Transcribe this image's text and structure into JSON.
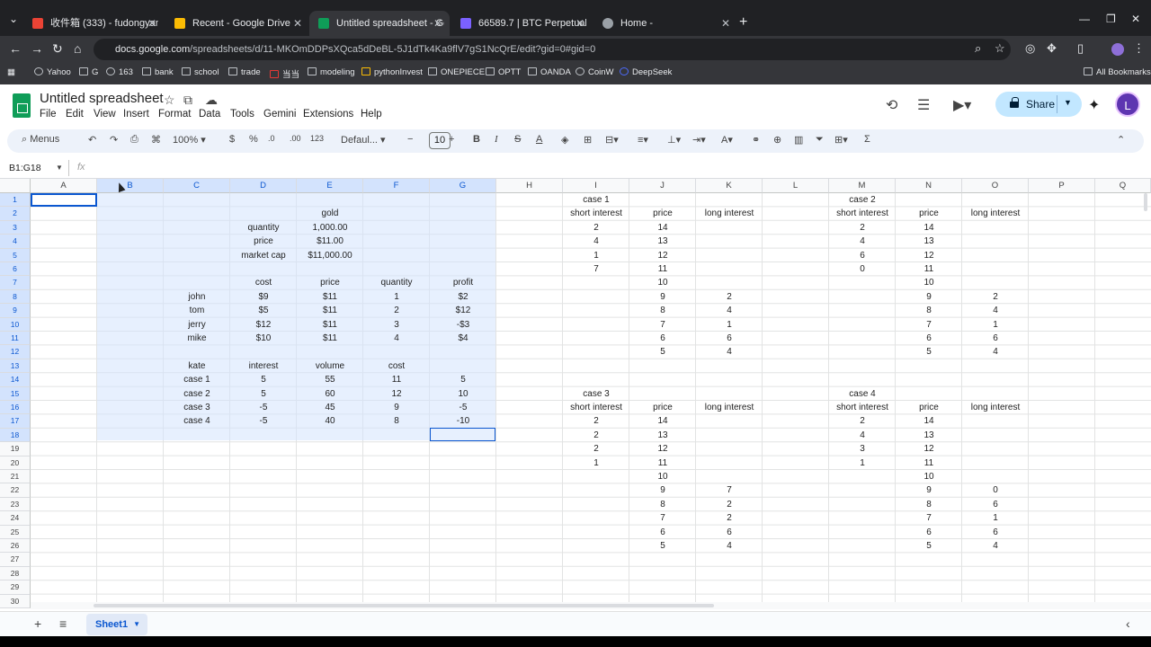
{
  "browser": {
    "tabs": [
      {
        "title": "收件箱 (333) - fudongyang880",
        "color": "#ea4335"
      },
      {
        "title": "Recent - Google Drive",
        "color": "#fbbc04"
      },
      {
        "title": "Untitled spreadsheet - Google",
        "color": "#0f9d58"
      },
      {
        "title": "66589.7 | BTC Perpetual | USDT",
        "color": "#7b61ff"
      },
      {
        "title": "Home -",
        "color": "#9aa0a6"
      }
    ],
    "url_host": "docs.google.com",
    "url_path": "/spreadsheets/d/11-MKOmDDPsXQca5dDeBL-5J1dTk4Ka9flV7gS1NcQrE/edit?gid=0#gid=0",
    "bookmarks": [
      "Yahoo",
      "G",
      "163",
      "bank",
      "school",
      "trade",
      "当当",
      "modeling",
      "pythonInvest",
      "ONEPIECE",
      "OPTT",
      "OANDA",
      "CoinW",
      "DeepSeek"
    ],
    "all_bookmarks": "All Bookmarks"
  },
  "sheets": {
    "title": "Untitled spreadsheet",
    "menu": [
      "File",
      "Edit",
      "View",
      "Insert",
      "Format",
      "Data",
      "Tools",
      "Gemini",
      "Extensions",
      "Help"
    ],
    "share_label": "Share",
    "avatar_letter": "L",
    "toolbar": {
      "menus": "Menus",
      "zoom": "100%",
      "currency": "$",
      "percent": "%",
      "dec_decrease": ".0",
      "dec_increase": ".00",
      "number_format": "123",
      "font": "Defaul...",
      "font_size": "10",
      "bold": "B",
      "italic": "I",
      "strikethrough": "S",
      "text_color": "A",
      "sum": "Σ"
    },
    "name_box": "B1:G18",
    "fx": "fx",
    "columns": [
      "A",
      "B",
      "C",
      "D",
      "E",
      "F",
      "G",
      "H",
      "I",
      "J",
      "K",
      "L",
      "M",
      "N",
      "O",
      "P",
      "Q"
    ],
    "rows": [
      "1",
      "2",
      "3",
      "4",
      "5",
      "6",
      "7",
      "8",
      "9",
      "10",
      "11",
      "12",
      "13",
      "14",
      "15",
      "16",
      "17",
      "18",
      "19",
      "20",
      "21",
      "22",
      "23",
      "24",
      "25",
      "26",
      "27",
      "28",
      "29",
      "30"
    ],
    "sheet_tab": "Sheet1",
    "cells": [
      {
        "c": "E",
        "r": 2,
        "v": "gold"
      },
      {
        "c": "D",
        "r": 3,
        "v": "quantity"
      },
      {
        "c": "E",
        "r": 3,
        "v": "1,000.00"
      },
      {
        "c": "D",
        "r": 4,
        "v": "price"
      },
      {
        "c": "E",
        "r": 4,
        "v": "$11.00"
      },
      {
        "c": "D",
        "r": 5,
        "v": "market cap"
      },
      {
        "c": "E",
        "r": 5,
        "v": "$11,000.00"
      },
      {
        "c": "D",
        "r": 7,
        "v": "cost"
      },
      {
        "c": "E",
        "r": 7,
        "v": "price"
      },
      {
        "c": "F",
        "r": 7,
        "v": "quantity"
      },
      {
        "c": "G",
        "r": 7,
        "v": "profit"
      },
      {
        "c": "C",
        "r": 8,
        "v": "john"
      },
      {
        "c": "D",
        "r": 8,
        "v": "$9"
      },
      {
        "c": "E",
        "r": 8,
        "v": "$11"
      },
      {
        "c": "F",
        "r": 8,
        "v": "1"
      },
      {
        "c": "G",
        "r": 8,
        "v": "$2"
      },
      {
        "c": "C",
        "r": 9,
        "v": "tom"
      },
      {
        "c": "D",
        "r": 9,
        "v": "$5"
      },
      {
        "c": "E",
        "r": 9,
        "v": "$11"
      },
      {
        "c": "F",
        "r": 9,
        "v": "2"
      },
      {
        "c": "G",
        "r": 9,
        "v": "$12"
      },
      {
        "c": "C",
        "r": 10,
        "v": "jerry"
      },
      {
        "c": "D",
        "r": 10,
        "v": "$12"
      },
      {
        "c": "E",
        "r": 10,
        "v": "$11"
      },
      {
        "c": "F",
        "r": 10,
        "v": "3"
      },
      {
        "c": "G",
        "r": 10,
        "v": "-$3"
      },
      {
        "c": "C",
        "r": 11,
        "v": "mike"
      },
      {
        "c": "D",
        "r": 11,
        "v": "$10"
      },
      {
        "c": "E",
        "r": 11,
        "v": "$11"
      },
      {
        "c": "F",
        "r": 11,
        "v": "4"
      },
      {
        "c": "G",
        "r": 11,
        "v": "$4"
      },
      {
        "c": "C",
        "r": 13,
        "v": "kate"
      },
      {
        "c": "D",
        "r": 13,
        "v": "interest"
      },
      {
        "c": "E",
        "r": 13,
        "v": "volume"
      },
      {
        "c": "F",
        "r": 13,
        "v": "cost"
      },
      {
        "c": "C",
        "r": 14,
        "v": "case 1"
      },
      {
        "c": "D",
        "r": 14,
        "v": "5"
      },
      {
        "c": "E",
        "r": 14,
        "v": "55"
      },
      {
        "c": "F",
        "r": 14,
        "v": "11"
      },
      {
        "c": "G",
        "r": 14,
        "v": "5"
      },
      {
        "c": "C",
        "r": 15,
        "v": "case 2"
      },
      {
        "c": "D",
        "r": 15,
        "v": "5"
      },
      {
        "c": "E",
        "r": 15,
        "v": "60"
      },
      {
        "c": "F",
        "r": 15,
        "v": "12"
      },
      {
        "c": "G",
        "r": 15,
        "v": "10"
      },
      {
        "c": "C",
        "r": 16,
        "v": "case 3"
      },
      {
        "c": "D",
        "r": 16,
        "v": "-5"
      },
      {
        "c": "E",
        "r": 16,
        "v": "45"
      },
      {
        "c": "F",
        "r": 16,
        "v": "9"
      },
      {
        "c": "G",
        "r": 16,
        "v": "-5"
      },
      {
        "c": "C",
        "r": 17,
        "v": "case 4"
      },
      {
        "c": "D",
        "r": 17,
        "v": "-5"
      },
      {
        "c": "E",
        "r": 17,
        "v": "40"
      },
      {
        "c": "F",
        "r": 17,
        "v": "8"
      },
      {
        "c": "G",
        "r": 17,
        "v": "-10"
      },
      {
        "c": "I",
        "r": 1,
        "v": "case 1"
      },
      {
        "c": "I",
        "r": 2,
        "v": "short interest"
      },
      {
        "c": "J",
        "r": 2,
        "v": "price"
      },
      {
        "c": "K",
        "r": 2,
        "v": "long interest"
      },
      {
        "c": "I",
        "r": 3,
        "v": "2"
      },
      {
        "c": "J",
        "r": 3,
        "v": "14"
      },
      {
        "c": "I",
        "r": 4,
        "v": "4"
      },
      {
        "c": "J",
        "r": 4,
        "v": "13"
      },
      {
        "c": "I",
        "r": 5,
        "v": "1"
      },
      {
        "c": "J",
        "r": 5,
        "v": "12"
      },
      {
        "c": "I",
        "r": 6,
        "v": "7"
      },
      {
        "c": "J",
        "r": 6,
        "v": "11"
      },
      {
        "c": "J",
        "r": 7,
        "v": "10"
      },
      {
        "c": "J",
        "r": 8,
        "v": "9"
      },
      {
        "c": "K",
        "r": 8,
        "v": "2"
      },
      {
        "c": "J",
        "r": 9,
        "v": "8"
      },
      {
        "c": "K",
        "r": 9,
        "v": "4"
      },
      {
        "c": "J",
        "r": 10,
        "v": "7"
      },
      {
        "c": "K",
        "r": 10,
        "v": "1"
      },
      {
        "c": "J",
        "r": 11,
        "v": "6"
      },
      {
        "c": "K",
        "r": 11,
        "v": "6"
      },
      {
        "c": "J",
        "r": 12,
        "v": "5"
      },
      {
        "c": "K",
        "r": 12,
        "v": "4"
      },
      {
        "c": "M",
        "r": 1,
        "v": "case 2"
      },
      {
        "c": "M",
        "r": 2,
        "v": "short interest"
      },
      {
        "c": "N",
        "r": 2,
        "v": "price"
      },
      {
        "c": "O",
        "r": 2,
        "v": "long interest"
      },
      {
        "c": "M",
        "r": 3,
        "v": "2"
      },
      {
        "c": "N",
        "r": 3,
        "v": "14"
      },
      {
        "c": "M",
        "r": 4,
        "v": "4"
      },
      {
        "c": "N",
        "r": 4,
        "v": "13"
      },
      {
        "c": "M",
        "r": 5,
        "v": "6"
      },
      {
        "c": "N",
        "r": 5,
        "v": "12"
      },
      {
        "c": "M",
        "r": 6,
        "v": "0"
      },
      {
        "c": "N",
        "r": 6,
        "v": "11"
      },
      {
        "c": "N",
        "r": 7,
        "v": "10"
      },
      {
        "c": "N",
        "r": 8,
        "v": "9"
      },
      {
        "c": "O",
        "r": 8,
        "v": "2"
      },
      {
        "c": "N",
        "r": 9,
        "v": "8"
      },
      {
        "c": "O",
        "r": 9,
        "v": "4"
      },
      {
        "c": "N",
        "r": 10,
        "v": "7"
      },
      {
        "c": "O",
        "r": 10,
        "v": "1"
      },
      {
        "c": "N",
        "r": 11,
        "v": "6"
      },
      {
        "c": "O",
        "r": 11,
        "v": "6"
      },
      {
        "c": "N",
        "r": 12,
        "v": "5"
      },
      {
        "c": "O",
        "r": 12,
        "v": "4"
      },
      {
        "c": "I",
        "r": 15,
        "v": "case 3"
      },
      {
        "c": "I",
        "r": 16,
        "v": "short interest"
      },
      {
        "c": "J",
        "r": 16,
        "v": "price"
      },
      {
        "c": "K",
        "r": 16,
        "v": "long interest"
      },
      {
        "c": "I",
        "r": 17,
        "v": "2"
      },
      {
        "c": "J",
        "r": 17,
        "v": "14"
      },
      {
        "c": "I",
        "r": 18,
        "v": "2"
      },
      {
        "c": "J",
        "r": 18,
        "v": "13"
      },
      {
        "c": "I",
        "r": 19,
        "v": "2"
      },
      {
        "c": "J",
        "r": 19,
        "v": "12"
      },
      {
        "c": "I",
        "r": 20,
        "v": "1"
      },
      {
        "c": "J",
        "r": 20,
        "v": "11"
      },
      {
        "c": "J",
        "r": 21,
        "v": "10"
      },
      {
        "c": "J",
        "r": 22,
        "v": "9"
      },
      {
        "c": "K",
        "r": 22,
        "v": "7"
      },
      {
        "c": "J",
        "r": 23,
        "v": "8"
      },
      {
        "c": "K",
        "r": 23,
        "v": "2"
      },
      {
        "c": "J",
        "r": 24,
        "v": "7"
      },
      {
        "c": "K",
        "r": 24,
        "v": "2"
      },
      {
        "c": "J",
        "r": 25,
        "v": "6"
      },
      {
        "c": "K",
        "r": 25,
        "v": "6"
      },
      {
        "c": "J",
        "r": 26,
        "v": "5"
      },
      {
        "c": "K",
        "r": 26,
        "v": "4"
      },
      {
        "c": "M",
        "r": 15,
        "v": "case 4"
      },
      {
        "c": "M",
        "r": 16,
        "v": "short interest"
      },
      {
        "c": "N",
        "r": 16,
        "v": "price"
      },
      {
        "c": "O",
        "r": 16,
        "v": "long interest"
      },
      {
        "c": "M",
        "r": 17,
        "v": "2"
      },
      {
        "c": "N",
        "r": 17,
        "v": "14"
      },
      {
        "c": "M",
        "r": 18,
        "v": "4"
      },
      {
        "c": "N",
        "r": 18,
        "v": "13"
      },
      {
        "c": "M",
        "r": 19,
        "v": "3"
      },
      {
        "c": "N",
        "r": 19,
        "v": "12"
      },
      {
        "c": "M",
        "r": 20,
        "v": "1"
      },
      {
        "c": "N",
        "r": 20,
        "v": "11"
      },
      {
        "c": "N",
        "r": 21,
        "v": "10"
      },
      {
        "c": "N",
        "r": 22,
        "v": "9"
      },
      {
        "c": "O",
        "r": 22,
        "v": "0"
      },
      {
        "c": "N",
        "r": 23,
        "v": "8"
      },
      {
        "c": "O",
        "r": 23,
        "v": "6"
      },
      {
        "c": "N",
        "r": 24,
        "v": "7"
      },
      {
        "c": "O",
        "r": 24,
        "v": "1"
      },
      {
        "c": "N",
        "r": 25,
        "v": "6"
      },
      {
        "c": "O",
        "r": 25,
        "v": "6"
      },
      {
        "c": "N",
        "r": 26,
        "v": "5"
      },
      {
        "c": "O",
        "r": 26,
        "v": "4"
      }
    ]
  }
}
